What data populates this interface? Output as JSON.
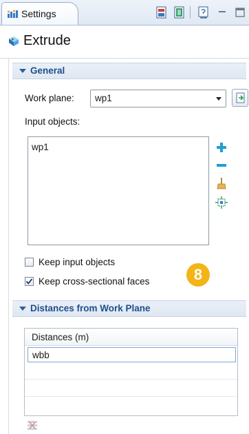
{
  "tab": {
    "title": "Settings"
  },
  "header": {
    "title": "Extrude"
  },
  "general": {
    "title": "General",
    "work_plane_label": "Work plane:",
    "work_plane_value": "wp1",
    "input_objects_label": "Input objects:",
    "input_objects": [
      "wp1"
    ],
    "keep_input_label": "Keep input objects",
    "keep_input_checked": false,
    "keep_faces_label": "Keep cross-sectional faces",
    "keep_faces_checked": true,
    "badge": "8"
  },
  "distances": {
    "title": "Distances from Work Plane",
    "column_header": "Distances (m)",
    "rows": [
      "wbb"
    ]
  },
  "colors": {
    "accent": "#1f4e8c",
    "badge": "#f2b417"
  }
}
